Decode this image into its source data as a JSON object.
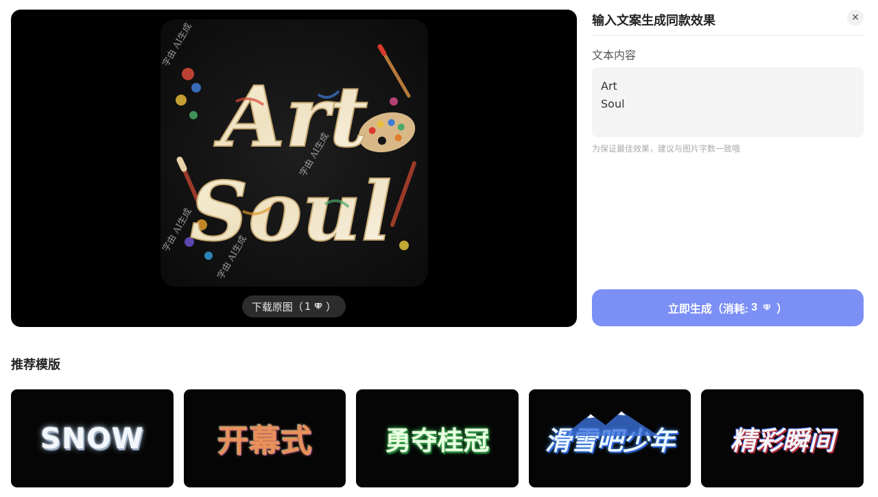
{
  "preview": {
    "artwork_text_line1": "Art",
    "artwork_text_line2": "Soul",
    "watermark": "字由 AI生成",
    "download_label": "下载原图（",
    "download_cost": "1",
    "download_close": "）"
  },
  "side": {
    "title": "输入文案生成同款效果",
    "close_icon": "close-icon",
    "field_label": "文本内容",
    "text_value": "Art\nSoul",
    "hint": "为保证最佳效果，建议与图片字数一致哦",
    "generate_label": "立即生成（消耗: ",
    "generate_cost": "3",
    "generate_close": "）"
  },
  "templates_section": {
    "title": "推荐模版",
    "items": [
      {
        "label": "SNOW"
      },
      {
        "label": "开幕式"
      },
      {
        "label": "勇夺桂冠"
      },
      {
        "label": "滑雪吧少年"
      },
      {
        "label": "精彩瞬间"
      }
    ]
  },
  "colors": {
    "accent": "#7b8ff5",
    "panel_bg": "#000000",
    "input_bg": "#f4f4f4"
  },
  "icons": {
    "gem": "diamond-gem-icon",
    "close": "close-icon"
  }
}
